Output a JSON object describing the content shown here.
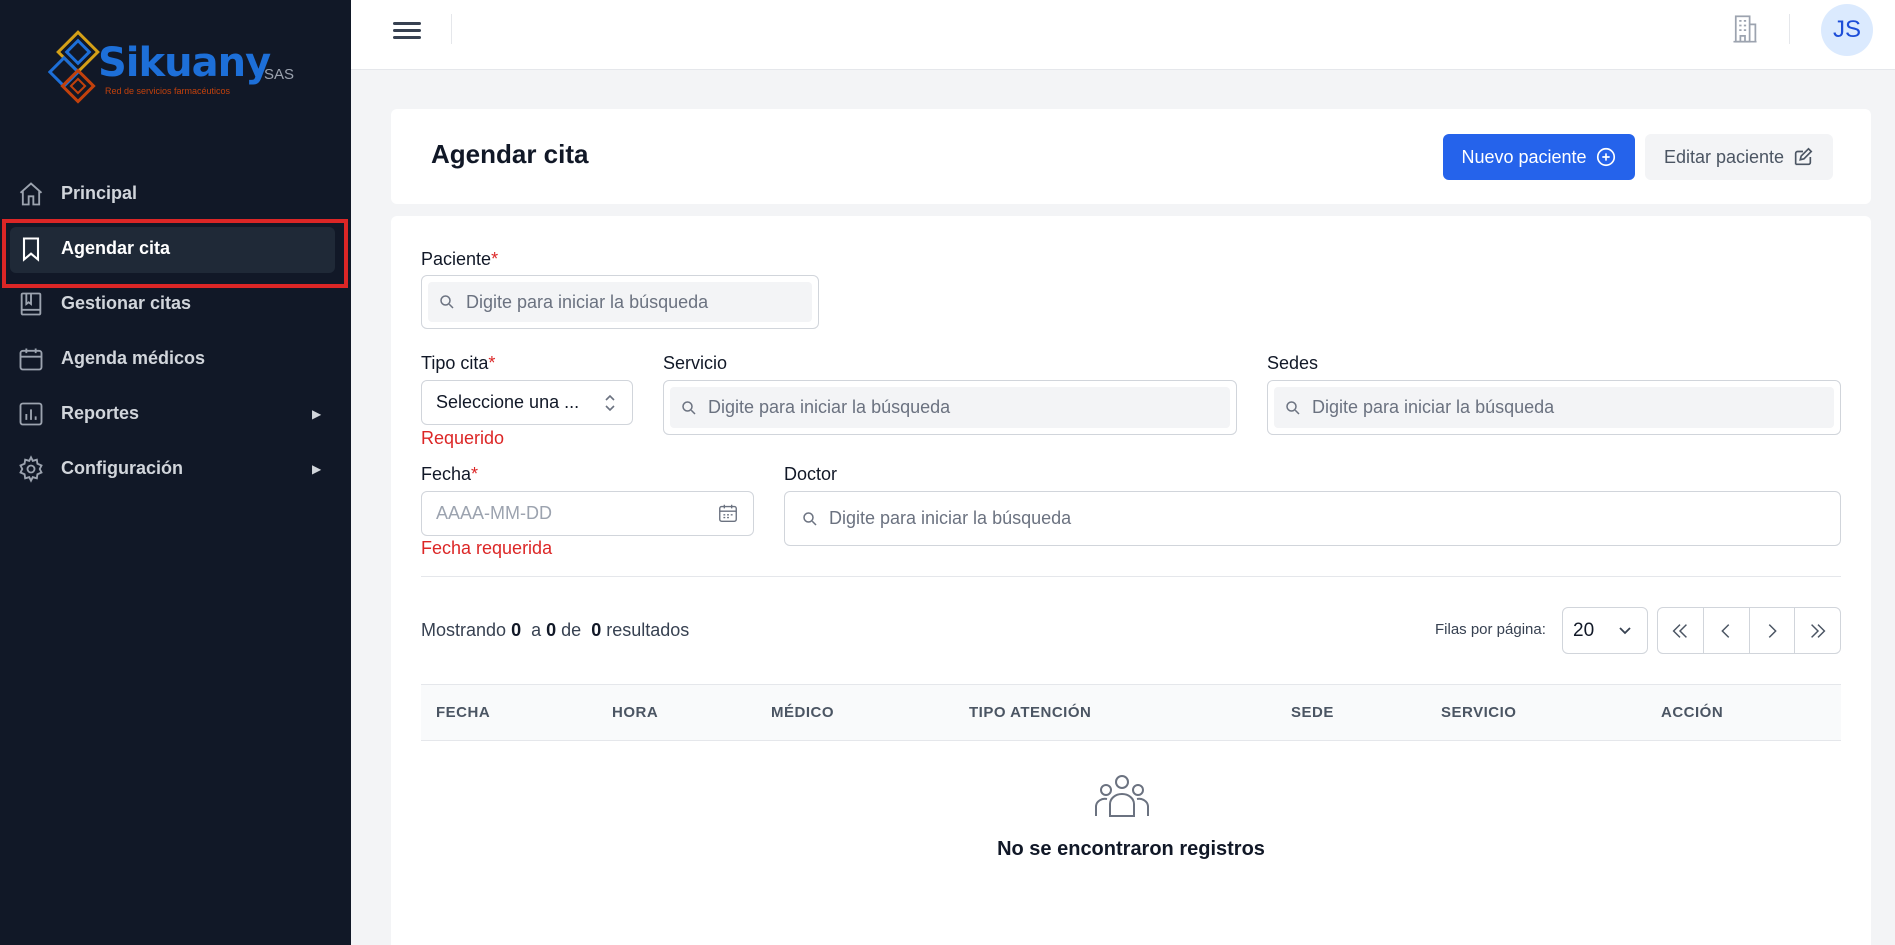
{
  "brand": {
    "name": "Sikuany",
    "suffix": "SAS",
    "tagline": "Red de servicios farmacéuticos"
  },
  "sidebar": {
    "items": [
      {
        "label": "Principal",
        "icon": "home-icon"
      },
      {
        "label": "Agendar cita",
        "icon": "bookmark-icon",
        "active": true
      },
      {
        "label": "Gestionar citas",
        "icon": "book-icon"
      },
      {
        "label": "Agenda médicos",
        "icon": "calendar-icon"
      },
      {
        "label": "Reportes",
        "icon": "chart-icon",
        "arrow": "▶"
      },
      {
        "label": "Configuración",
        "icon": "gear-icon",
        "arrow": "▶"
      }
    ]
  },
  "topbar": {
    "avatar_initials": "JS"
  },
  "header": {
    "title": "Agendar cita",
    "new_patient_label": "Nuevo paciente",
    "edit_patient_label": "Editar paciente"
  },
  "form": {
    "paciente": {
      "label": "Paciente",
      "required": "*",
      "placeholder": "Digite para iniciar la búsqueda"
    },
    "tipo_cita": {
      "label": "Tipo cita",
      "required": "*",
      "value": "Seleccione una ...",
      "error": "Requerido"
    },
    "servicio": {
      "label": "Servicio",
      "placeholder": "Digite para iniciar la búsqueda"
    },
    "sedes": {
      "label": "Sedes",
      "placeholder": "Digite para iniciar la búsqueda"
    },
    "fecha": {
      "label": "Fecha",
      "required": "*",
      "placeholder": "AAAA-MM-DD",
      "error": "Fecha requerida"
    },
    "doctor": {
      "label": "Doctor",
      "placeholder": "Digite para iniciar la búsqueda"
    }
  },
  "results": {
    "prefix": "Mostrando",
    "from": "0",
    "mid": "a",
    "to": "0",
    "of": "de",
    "total": "0",
    "suffix": "resultados",
    "rows_per_page_label": "Filas por página:",
    "rows_per_page": "20"
  },
  "table": {
    "columns": [
      "FECHA",
      "HORA",
      "MÉDICO",
      "TIPO ATENCIÓN",
      "SEDE",
      "SERVICIO",
      "ACCIÓN"
    ],
    "empty_message": "No se encontraron registros"
  },
  "colors": {
    "sidebar_bg": "#111827",
    "primary": "#2563eb",
    "error": "#dc2626",
    "highlight": "#dc2626"
  }
}
